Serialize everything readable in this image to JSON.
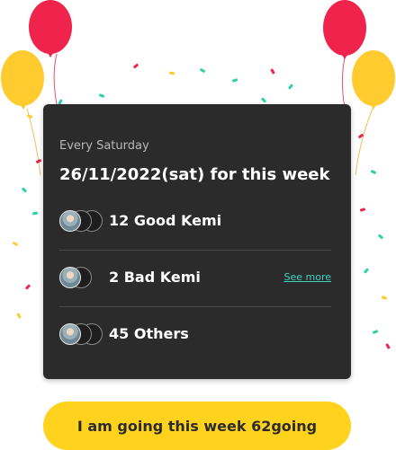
{
  "card": {
    "schedule_label": "Every Saturday",
    "date_title": "26/11/2022(sat) for this week",
    "rows": [
      {
        "label": "12 Good Kemi"
      },
      {
        "label": "2 Bad Kemi",
        "link": "See more"
      },
      {
        "label": "45 Others"
      }
    ]
  },
  "cta": {
    "label": "I am going this week 62going"
  },
  "colors": {
    "card_background": "#2b2b2b",
    "cta_yellow": "#ffd21e",
    "link_teal": "#3fd3c0",
    "balloon_red": "#f0234d",
    "balloon_yellow": "#ffcb2f"
  }
}
